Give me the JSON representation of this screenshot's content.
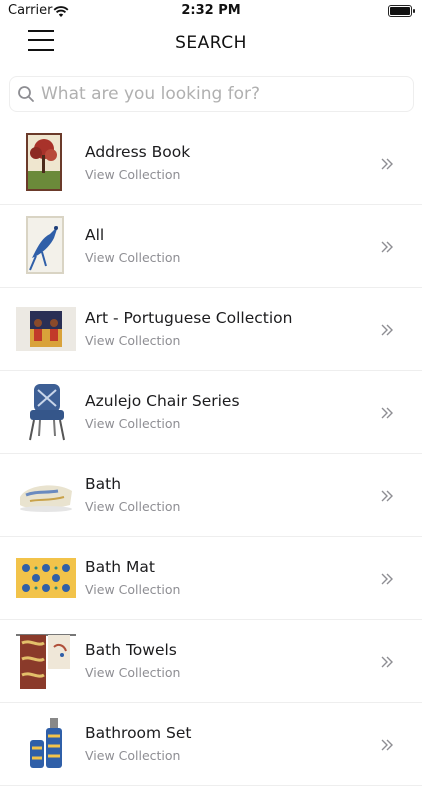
{
  "status_bar": {
    "carrier": "Carrier",
    "time": "2:32 PM"
  },
  "header": {
    "title": "SEARCH",
    "menu_icon": "hamburger-menu-icon"
  },
  "search": {
    "placeholder": "What are you looking for?",
    "value": "",
    "icon": "search-icon"
  },
  "items": [
    {
      "title": "Address Book",
      "subtitle": "View Collection",
      "thumb": "book-tree"
    },
    {
      "title": "All",
      "subtitle": "View Collection",
      "thumb": "book-bird"
    },
    {
      "title": "Art - Portuguese Collection",
      "subtitle": "View Collection",
      "thumb": "art-figures"
    },
    {
      "title": "Azulejo Chair Series",
      "subtitle": "View Collection",
      "thumb": "chair"
    },
    {
      "title": "Bath",
      "subtitle": "View Collection",
      "thumb": "towel-rolled"
    },
    {
      "title": "Bath Mat",
      "subtitle": "View Collection",
      "thumb": "bath-mat"
    },
    {
      "title": "Bath Towels",
      "subtitle": "View Collection",
      "thumb": "towels"
    },
    {
      "title": "Bathroom Set",
      "subtitle": "View Collection",
      "thumb": "bathroom-set"
    }
  ],
  "colors": {
    "text": "#1c1c1e",
    "subtitle": "#8e8e93",
    "divider": "#eeeeee",
    "tile_yellow": "#f2c34a",
    "tile_blue": "#2f5fa8"
  }
}
